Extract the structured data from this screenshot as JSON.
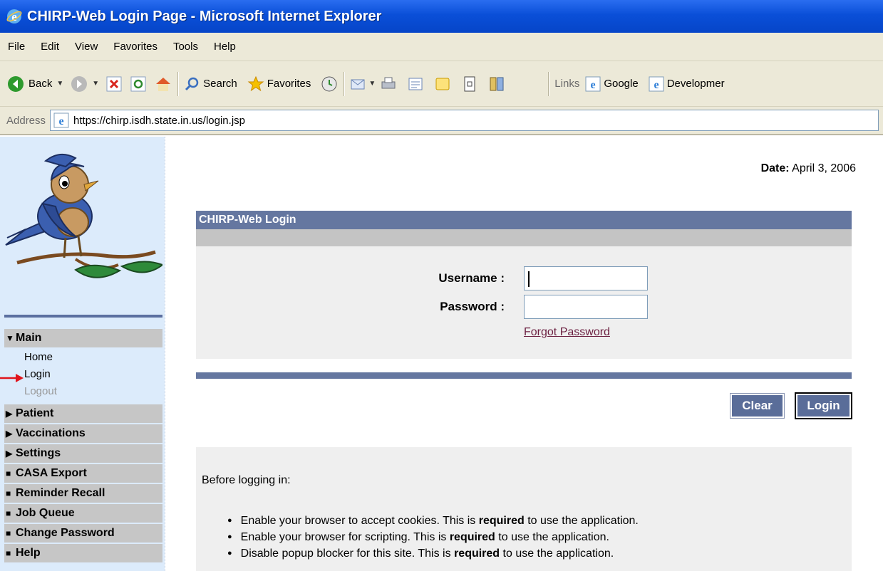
{
  "window": {
    "title": "CHIRP-Web Login Page - Microsoft Internet Explorer"
  },
  "menu": [
    "File",
    "Edit",
    "View",
    "Favorites",
    "Tools",
    "Help"
  ],
  "toolbar": {
    "back_label": "Back",
    "search_label": "Search",
    "favorites_label": "Favorites",
    "links_label": "Links",
    "link_google": "Google",
    "link_developer": "Developmer"
  },
  "address": {
    "label": "Address",
    "url": "https://chirp.isdh.state.in.us/login.jsp"
  },
  "sidebar": {
    "main_header": "Main",
    "main_links": [
      "Home",
      "Login",
      "Logout"
    ],
    "sections": [
      {
        "marker": "triangle",
        "label": "Patient"
      },
      {
        "marker": "triangle",
        "label": "Vaccinations"
      },
      {
        "marker": "triangle",
        "label": "Settings"
      },
      {
        "marker": "square",
        "label": "CASA Export"
      },
      {
        "marker": "square",
        "label": "Reminder Recall"
      },
      {
        "marker": "square",
        "label": "Job Queue"
      },
      {
        "marker": "square",
        "label": "Change Password"
      },
      {
        "marker": "square",
        "label": "Help"
      }
    ]
  },
  "page": {
    "date_label": "Date:",
    "date_value": "April 3, 2006"
  },
  "login": {
    "title": "CHIRP-Web Login",
    "username_label": "Username :",
    "password_label": "Password :",
    "username_value": "",
    "password_value": "",
    "forgot_password": "Forgot Password",
    "clear_button": "Clear",
    "login_button": "Login"
  },
  "info": {
    "intro": "Before logging in:",
    "items": [
      {
        "before": "Enable your browser to accept cookies. This is ",
        "bold": "required",
        "after": " to use the application."
      },
      {
        "before": "Enable your browser for scripting. This is ",
        "bold": "required",
        "after": " to use the application."
      },
      {
        "before": "Disable popup blocker for this site. This is ",
        "bold": "required",
        "after": " to use the application."
      }
    ]
  }
}
